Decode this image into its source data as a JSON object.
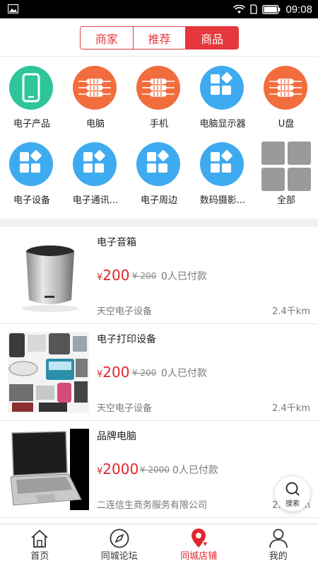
{
  "status_bar": {
    "time": "09:08"
  },
  "tabs": [
    {
      "label": "商家",
      "active": false
    },
    {
      "label": "推荐",
      "active": false
    },
    {
      "label": "商品",
      "active": true
    }
  ],
  "categories": [
    {
      "label": "电子产品",
      "icon": "phone-icon",
      "color": "#2ec59a"
    },
    {
      "label": "电脑",
      "icon": "resistor-icon",
      "color": "#f26d3d"
    },
    {
      "label": "手机",
      "icon": "resistor-icon",
      "color": "#f26d3d"
    },
    {
      "label": "电脑显示器",
      "icon": "app-grid-icon",
      "color": "#3eabf0"
    },
    {
      "label": "U盘",
      "icon": "resistor-icon",
      "color": "#f26d3d"
    },
    {
      "label": "电子设备",
      "icon": "app-grid-icon",
      "color": "#3eabf0"
    },
    {
      "label": "电子通讯...",
      "icon": "app-grid-icon",
      "color": "#3eabf0"
    },
    {
      "label": "电子周边",
      "icon": "app-grid-icon",
      "color": "#3eabf0"
    },
    {
      "label": "数码摄影...",
      "icon": "app-grid-icon",
      "color": "#3eabf0"
    },
    {
      "label": "全部",
      "icon": "all-grid-icon",
      "color": "#9a9a9a"
    }
  ],
  "products": [
    {
      "name": "电子音箱",
      "currency": "¥",
      "price": "200",
      "old_price": "¥ 200",
      "sold": "0人已付款",
      "shop": "天空电子设备",
      "distance": "2.4千km"
    },
    {
      "name": "电子打印设备",
      "currency": "¥",
      "price": "200",
      "old_price": "¥ 200",
      "sold": "0人已付款",
      "shop": "天空电子设备",
      "distance": "2.4千km"
    },
    {
      "name": "品牌电脑",
      "currency": "¥",
      "price": "2000",
      "old_price": "¥ 2000",
      "sold": "0人已付款",
      "shop": "二连信生商务服务有限公司",
      "distance": "2.4千km"
    }
  ],
  "search_fab": {
    "label": "搜索"
  },
  "bottom_nav": [
    {
      "label": "首页",
      "icon": "home-icon",
      "active": false
    },
    {
      "label": "同城论坛",
      "icon": "compass-icon",
      "active": false
    },
    {
      "label": "同城店铺",
      "icon": "location-pin-icon",
      "active": true
    },
    {
      "label": "我的",
      "icon": "person-icon",
      "active": false
    }
  ],
  "colors": {
    "accent": "#e6373c",
    "price": "#e2262b"
  }
}
